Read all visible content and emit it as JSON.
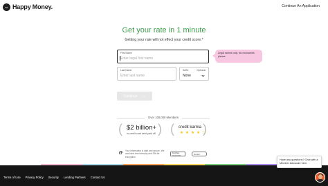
{
  "header": {
    "logo_text": "Happy Money.",
    "continue_link": "Continue An Application"
  },
  "main": {
    "title": "Get your rate in 1 minute",
    "subtitle": "Getting your rate will not effect your credit score.*"
  },
  "form": {
    "first_name": {
      "label": "First Name",
      "placeholder": "Enter legal first name",
      "value": ""
    },
    "last_name": {
      "label": "Last Name",
      "placeholder": "Enter last name",
      "value": ""
    },
    "suffix": {
      "label": "Suffix",
      "optional_label": "Optional",
      "value": "None"
    },
    "tooltip": "Legal names only. No nicknames please.",
    "continue_button": "Continue",
    "continue_arrow": "→"
  },
  "social_proof": {
    "members_text": "Over 100,000 Members",
    "amount": "$2 billion+",
    "amount_sub": "in credit card debt paid off",
    "credit_karma": "credit karma",
    "stars": "★ ★ ★ ★ ☆",
    "rating": 4.5
  },
  "security": {
    "text": "Your information is safe and secure. We use bank-level security and 256-bit encryption.",
    "badges": [
      "McAfee SECURE",
      "Norton"
    ]
  },
  "footer": {
    "links": [
      "Terms of Use",
      "Privacy Policy",
      "Security",
      "Lending Partners",
      "Contact Us"
    ],
    "stripe_colors": [
      "#ffffff",
      "#f2b6d2",
      "#a8d8f0",
      "#f7a35c",
      "#fbd75b",
      "#7ccd7c",
      "#a98ae8",
      "#ffffff"
    ]
  },
  "chat": {
    "message": "Have any questions? Chat with a Member Advocate here."
  },
  "colors": {
    "accent": "#3b9a4b",
    "tooltip_bg": "#f7c6e0",
    "footer_bg": "#151515",
    "disabled_button": "#e7e7e7"
  }
}
